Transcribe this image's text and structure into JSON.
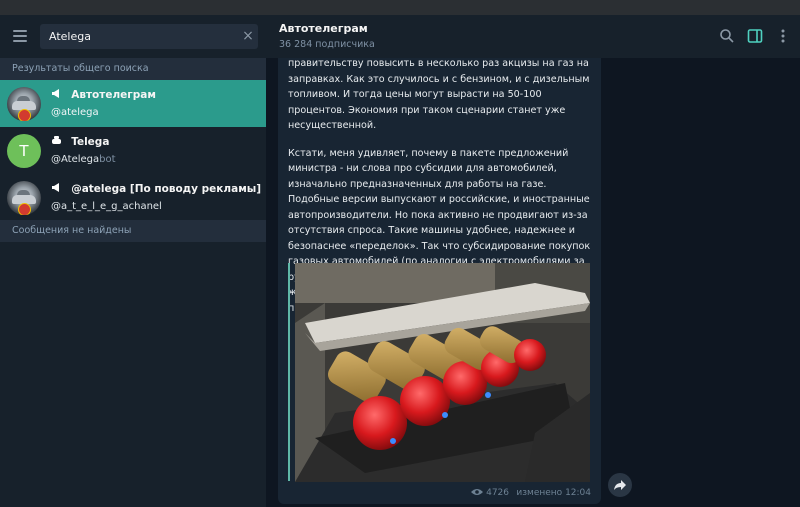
{
  "search": {
    "value": "Atelega",
    "clear_icon": "×"
  },
  "left": {
    "global_search_label": "Результаты общего поиска",
    "results": [
      {
        "title": "Автотелеграм",
        "type_icon": "megaphone",
        "username": "@atelega",
        "username_dim": "",
        "avatar": "car-logo",
        "active": true
      },
      {
        "title": "Telega",
        "type_icon": "bot",
        "username": "@Atelega",
        "username_dim": "bot",
        "avatar_letter": "T",
        "active": false
      },
      {
        "title": "@atelega [По поводу рекламы]",
        "type_icon": "megaphone",
        "username": "@a_t_e_l_e_g_achanel",
        "username_dim": "",
        "avatar": "car-logo",
        "active": false
      }
    ],
    "messages_not_found": "Сообщения не найдены"
  },
  "header": {
    "title": "Автотелеграм",
    "subscribers": "36 284 подписчика",
    "icons": [
      "search-icon",
      "sidebar-toggle-icon",
      "more-vertical-icon"
    ]
  },
  "message": {
    "paragraph1": "правительству повысить в несколько раз акцизы на газ на заправках. Как это случилось и с бензином, и с дизельным топливом. И тогда цены могут вырасти на 50-100 процентов. Экономия при таком сценарии станет уже несущественной.",
    "paragraph2": "Кстати, меня удивляет, почему в пакете предложений министра - ни слова про субсидии для автомобилей, изначально предназначенных для работы на газе. Подобные версии выпускают и российские, и иностранные автопроизводители. Но пока активно не продвигают из-за отсутствия спроса. Такие машины удобнее, надежнее и безопаснее «переделок». Так что субсидирование покупок газовых автомобилей (по аналогии с электромобилями за рубежом) выглядело бы и логично, и цивилизованно. У нас же сделали ставку на кустарный вариант. Наверное, не просто так.",
    "views": "4726",
    "edited_label": "изменено",
    "time": "12:04"
  },
  "colors": {
    "accent": "#2b9b8c",
    "sidebar_bg": "#17212b",
    "chat_bg": "#0e1621",
    "bubble_bg": "#182533"
  }
}
